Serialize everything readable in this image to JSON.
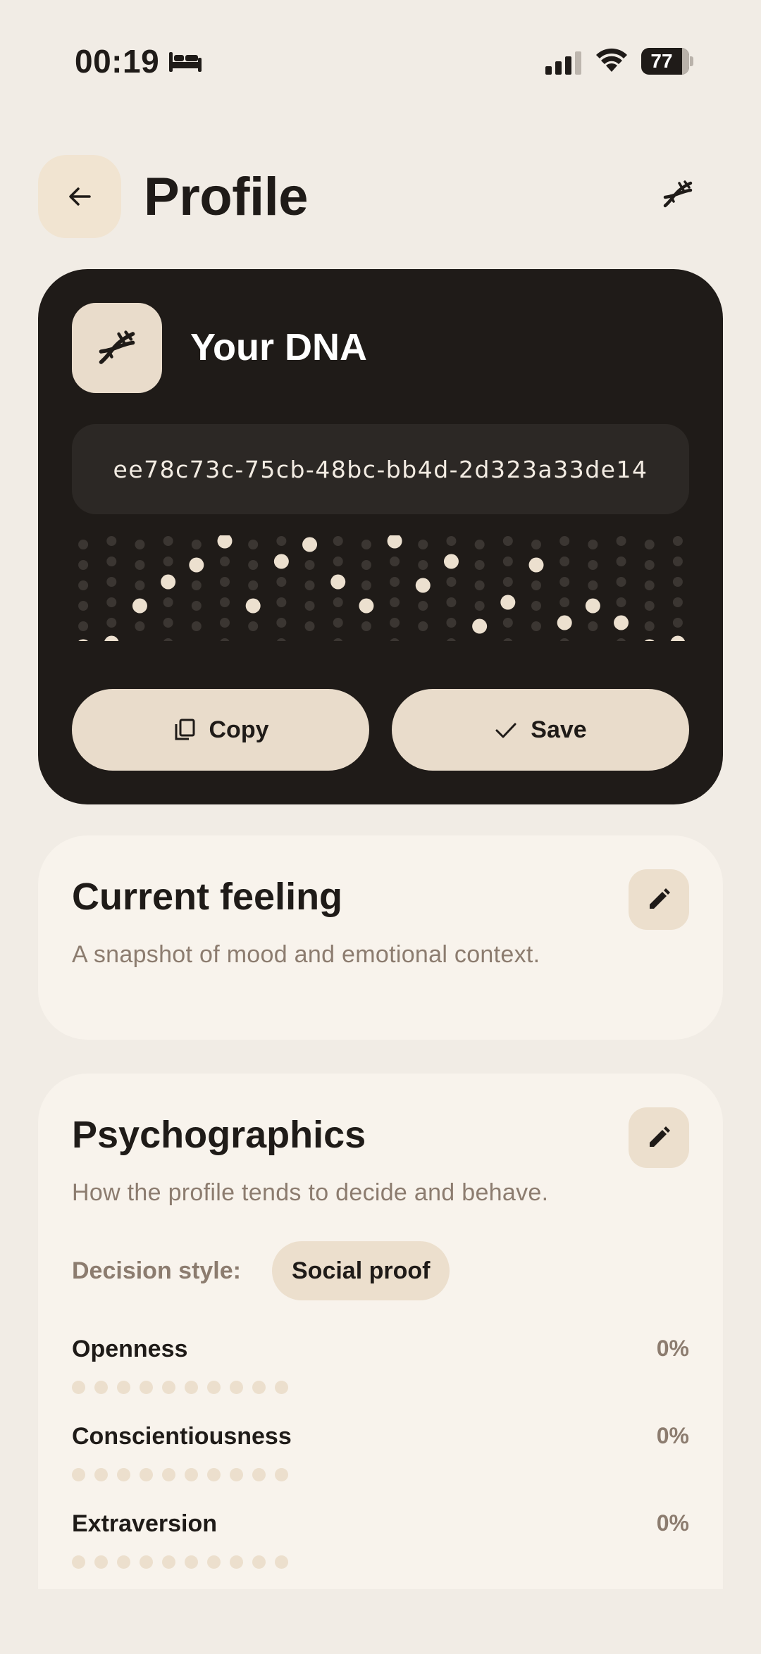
{
  "status_bar": {
    "time": "00:19",
    "battery": "77"
  },
  "header": {
    "title": "Profile"
  },
  "dna_card": {
    "title": "Your DNA",
    "dna_id": "ee78c73c-75cb-48bc-bb4d-2d323a33de14",
    "copy_label": "Copy",
    "save_label": "Save",
    "pattern_levels": [
      0,
      0,
      2,
      3,
      4,
      5,
      2,
      4,
      5,
      3,
      2,
      5,
      3,
      4,
      1,
      2,
      4,
      1,
      2,
      1,
      0,
      0
    ]
  },
  "feeling": {
    "title": "Current feeling",
    "description": "A snapshot of mood and emotional context."
  },
  "psychographics": {
    "title": "Psychographics",
    "description": "How the profile tends to decide and behave.",
    "decision_label": "Decision style:",
    "decision_value": "Social proof",
    "traits": [
      {
        "name": "Openness",
        "value": "0%"
      },
      {
        "name": "Conscientiousness",
        "value": "0%"
      },
      {
        "name": "Extraversion",
        "value": "0%"
      }
    ]
  },
  "colors": {
    "background": "#f1ece5",
    "card_dark": "#1f1b18",
    "accent_beige": "#e9dccb",
    "muted_text": "#8c7c6f"
  }
}
